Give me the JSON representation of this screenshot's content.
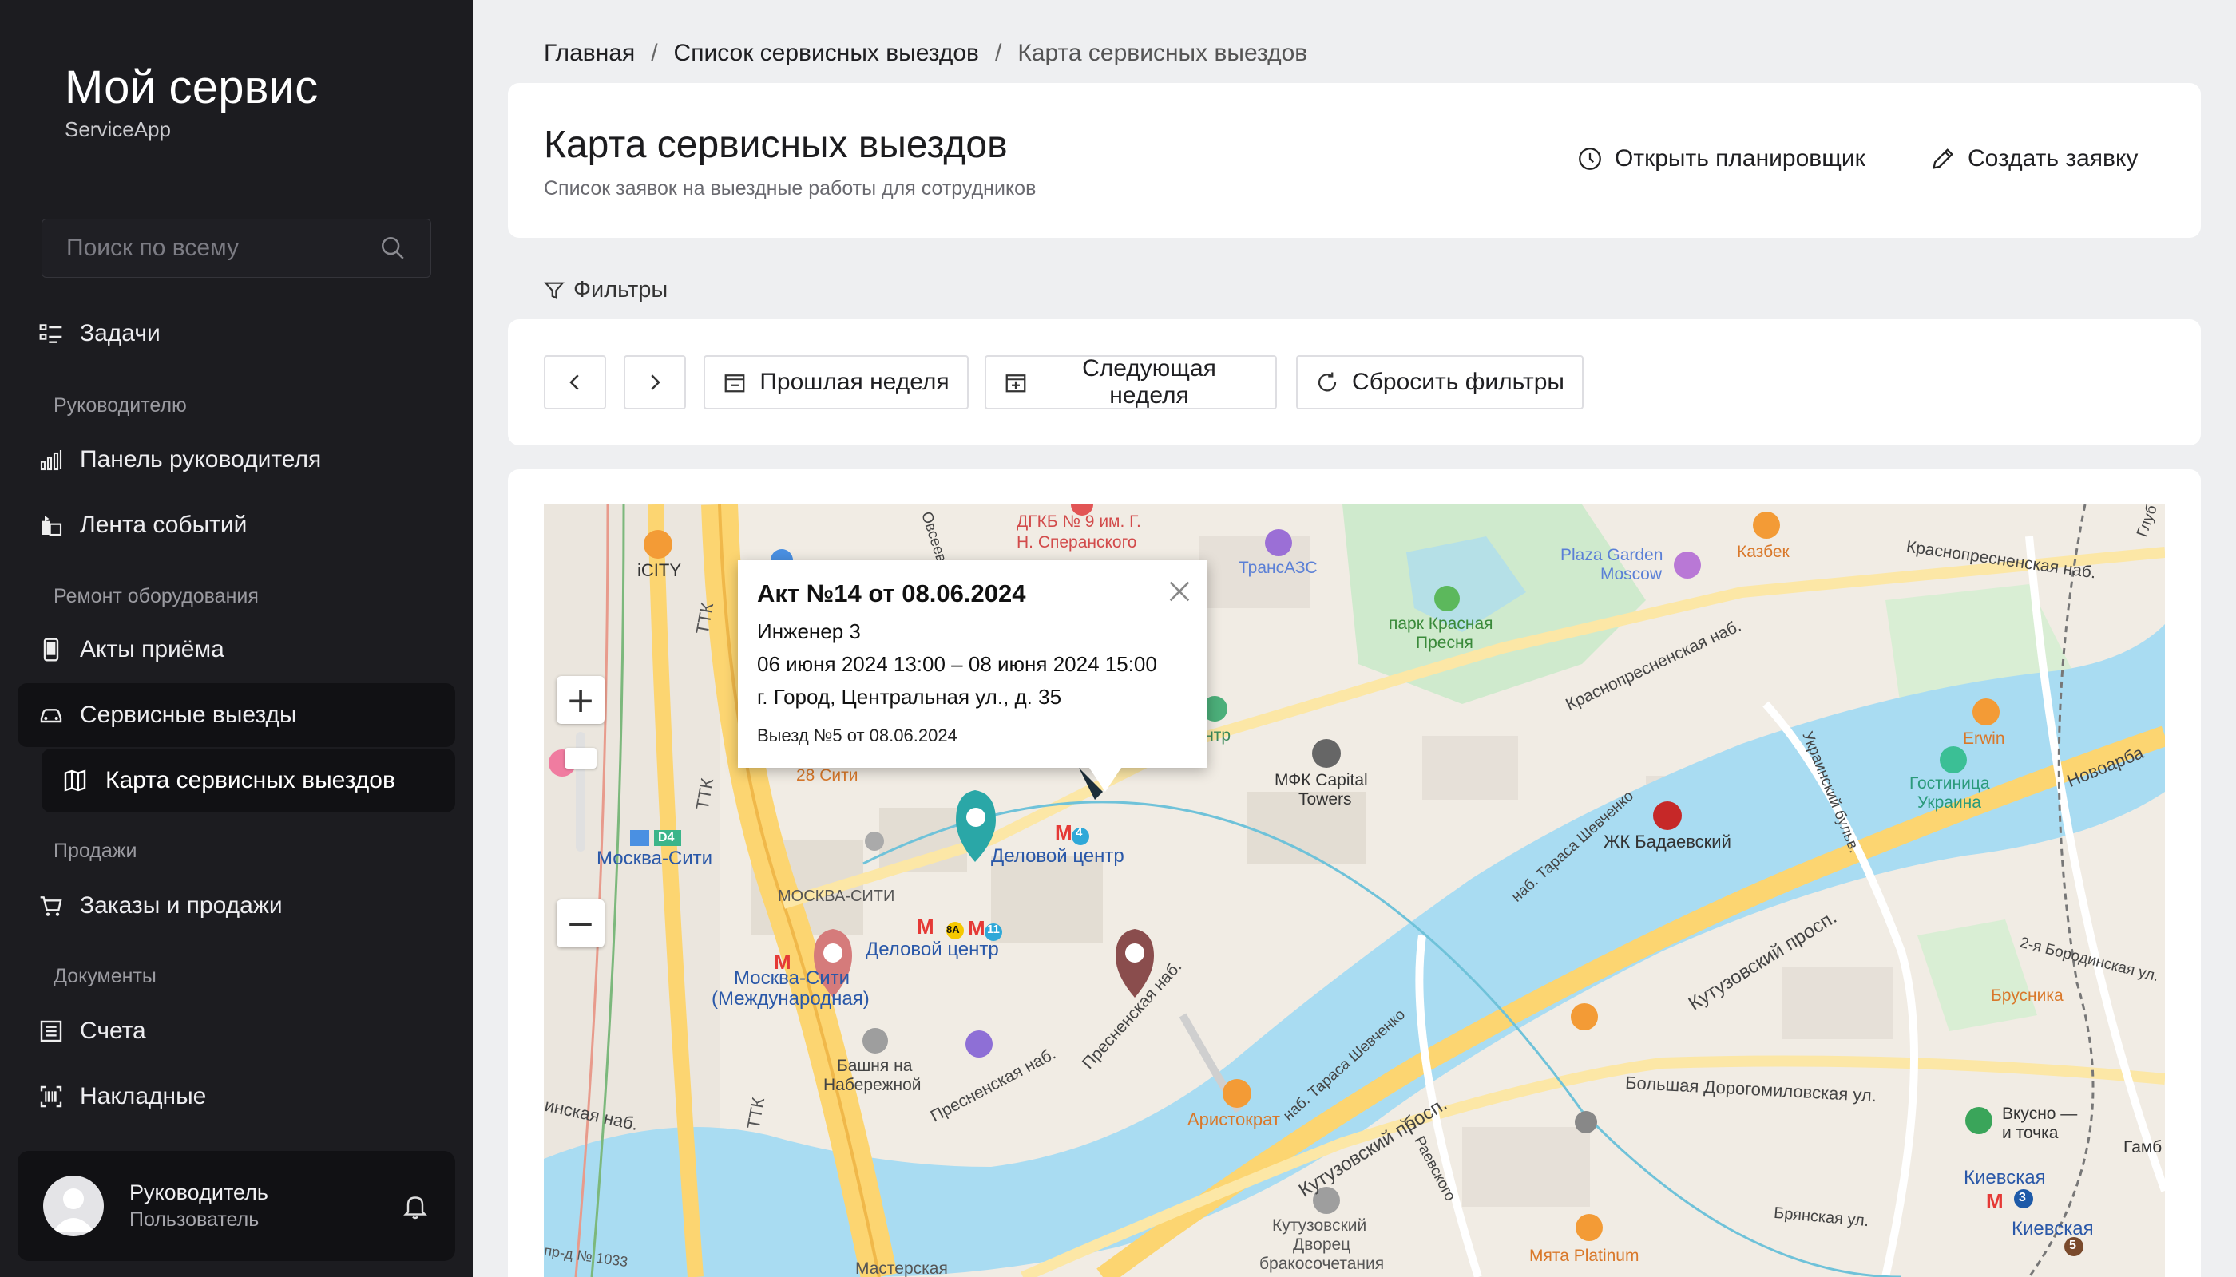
{
  "brand": {
    "title": "Мой сервис",
    "subtitle": "ServiceApp"
  },
  "search": {
    "placeholder": "Поиск по всему"
  },
  "sidebar": {
    "items": [
      {
        "label": "Задачи"
      },
      {
        "label": "Панель руководителя"
      },
      {
        "label": "Лента событий"
      },
      {
        "label": "Акты приёма"
      },
      {
        "label": "Сервисные выезды"
      },
      {
        "label": "Карта сервисных выездов"
      },
      {
        "label": "Заказы и продажи"
      },
      {
        "label": "Счета"
      },
      {
        "label": "Накладные"
      }
    ],
    "sections": [
      "Руководителю",
      "Ремонт оборудования",
      "Продажи",
      "Документы"
    ]
  },
  "user": {
    "name": "Руководитель",
    "role": "Пользователь"
  },
  "breadcrumb": {
    "home": "Главная",
    "list": "Список сервисных выездов",
    "current": "Карта сервисных выездов",
    "sep": "/"
  },
  "header": {
    "title": "Карта сервисных выездов",
    "subtitle": "Список заявок на выездные работы для сотрудников",
    "planner_label": "Открыть планировщик",
    "create_label": "Создать заявку"
  },
  "filters": {
    "label": "Фильтры",
    "prev_week": "Прошлая неделя",
    "next_week": "Следующая неделя",
    "reset": "Сбросить фильтры"
  },
  "popup": {
    "title": "Акт №14 от 08.06.2024",
    "engineer": "Инженер 3",
    "period": "06 июня 2024 13:00 – 08 июня 2024 15:00",
    "address": "г. Город, Центральная ул., д. 35",
    "footer": "Выезд №5 от 08.06.2024"
  },
  "map_labels": {
    "icity": "iCITY",
    "dgkb": "ДГКБ № 9 им. Г.",
    "dgkb2": "Н. Сперанского",
    "transazs": "ТрансАЗС",
    "plaza": "Plaza Garden",
    "plaza2": "Moscow",
    "kazbek": "Казбек",
    "krasnopresnenskaya": "Краснопресненская наб.",
    "krasnopresnenskaya2": "Краснопресненская наб.",
    "park": "парк Красная",
    "park2": "Пресня",
    "center": "Центр",
    "mfk": "МФК Capital",
    "mfk2": "Towers",
    "erwin": "Erwin",
    "ukraina": "Гостиница",
    "ukraina2": "Украина",
    "novoarb": "Новоарба",
    "badaevsky": "ЖК Бадаевский",
    "shevchenko": "наб. Тараса Шевченко",
    "ukrbulv": "Украинский бульв.",
    "moscowcity": "Москва-Сити",
    "delovoy": "Деловой центр",
    "delovoy2": "Деловой центр",
    "moscowcitybld": "МОСКВА-СИТИ",
    "mcintl": "Москва-Сити",
    "mcintl2": "(Международная)",
    "bashnya": "Башня на",
    "bashnya2": "Набережной",
    "presnya": "Пресненская наб.",
    "presnya2": "Пресненская наб.",
    "kutuz": "Кутузовский просп.",
    "kutuz2": "Кутузовский просп.",
    "aristokrat": "Аристократ",
    "shevchenko2": "наб. Тараса Шевченко",
    "dorogom": "Большая Дорогомиловская ул.",
    "raevskogo": "ул. Раевского",
    "kutuzpalace": "Кутузовский",
    "kutuzpalace2": "Дворец",
    "kutuzpalace3": "бракосочетания",
    "mata": "Мята Platinum",
    "bryanskaya": "Брянская ул.",
    "kievskaya": "Киевская",
    "kievskaya2": "Киевская",
    "vkusno": "Вкусно —",
    "vkusno2": "и точка",
    "brusnika": "Брусника",
    "borodino": "2-я Бородинская ул.",
    "ttk": "ТТК",
    "ttk2": "ТТК",
    "ttk3": "ТТК",
    "gamb": "Гамб",
    "masterskaya": "Мастерская",
    "nab": "инская наб.",
    "prd": "пр-д № 1033",
    "glub": "Глуб",
    "city28": "28 Сити",
    "ovseev": "Овсеев",
    "metro_num4": "4",
    "metro_num11": "11",
    "metro_8a": "8А",
    "metro_d4": "D4",
    "metro_3": "3",
    "metro_5": "5"
  },
  "colors": {
    "accent_dark": "#111114",
    "sidebar": "#1c1c20",
    "water": "#a9dcf2",
    "road_yellow": "#fcd571",
    "park": "#cfeacd"
  }
}
